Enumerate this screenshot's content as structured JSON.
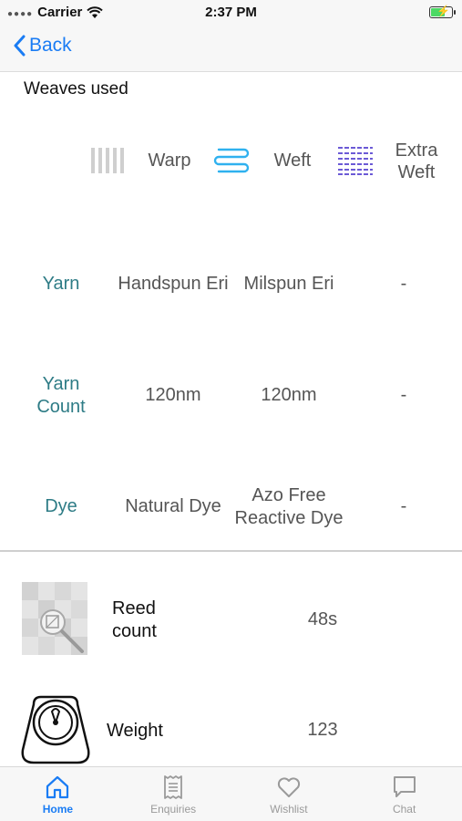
{
  "status_bar": {
    "carrier": "Carrier",
    "time": "2:37 PM",
    "battery_level": 0.7
  },
  "nav": {
    "back_label": "Back"
  },
  "section_title": "Weaves used",
  "columns": [
    {
      "label": "Warp",
      "icon": "warp-icon"
    },
    {
      "label": "Weft",
      "icon": "weft-icon"
    },
    {
      "label": "Extra\nWeft",
      "icon": "extra-weft-icon"
    }
  ],
  "rows": [
    {
      "label": "Yarn",
      "values": [
        "Handspun Eri",
        "Milspun Eri",
        "-"
      ]
    },
    {
      "label": "Yarn\nCount",
      "values": [
        "120nm",
        "120nm",
        "-"
      ]
    },
    {
      "label": "Dye",
      "values": [
        "Natural Dye",
        "Azo Free\nReactive Dye",
        "-"
      ]
    }
  ],
  "features": [
    {
      "label": "Reed\ncount",
      "value": "48s",
      "icon": "reed-count-icon"
    },
    {
      "label": "Weight",
      "value": "123",
      "icon": "weight-scale-icon"
    }
  ],
  "tabs": [
    {
      "label": "Home",
      "icon": "home-icon",
      "active": true
    },
    {
      "label": "Enquiries",
      "icon": "receipt-icon",
      "active": false
    },
    {
      "label": "Wishlist",
      "icon": "heart-icon",
      "active": false
    },
    {
      "label": "Chat",
      "icon": "chat-icon",
      "active": false
    }
  ],
  "colors": {
    "accent": "#1a7cf4",
    "row_label": "#2e7c86"
  }
}
